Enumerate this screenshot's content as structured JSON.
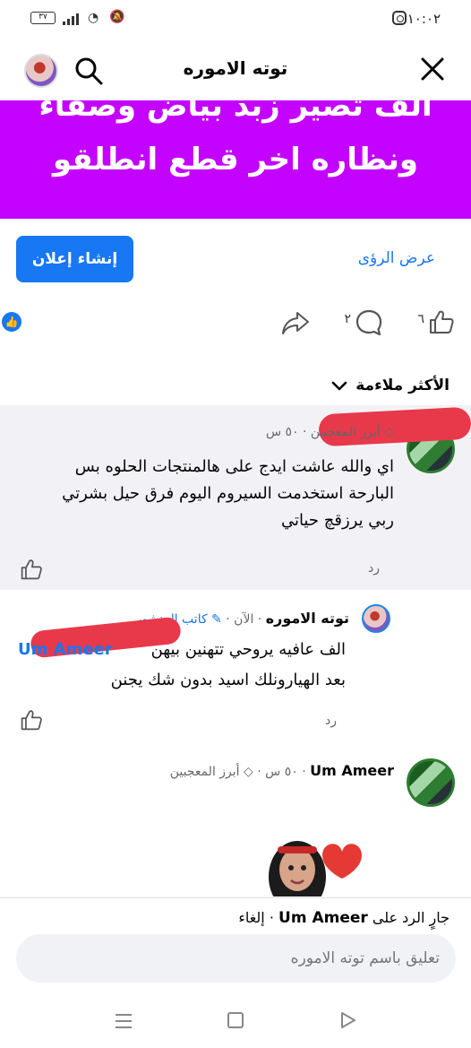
{
  "status_bar": {
    "time": "١٠:٠٢",
    "battery": "٣٧"
  },
  "header": {
    "title": "توته الاموره"
  },
  "banner": {
    "line1": "الف تصير زبد بياض وصفاء",
    "line2": "ونظاره اخر قطع انطلقو"
  },
  "actions": {
    "view_insights": "عرض الرؤى",
    "create_ad": "إنشاء إعلان"
  },
  "reactions": {
    "like_count": "٦",
    "comment_count": "٢"
  },
  "sort": {
    "label": "الأكثر ملاءمة"
  },
  "comments": [
    {
      "time": "٥٠ س",
      "badge": "أبرز المعجبين",
      "text_lines": [
        "اي والله عاشت ايدج على هالمنتجات الحلوه بس",
        "البارحة استخدمت السيروم اليوم فرق حيل بشرتي",
        "ربي يرزقچ حياتي"
      ],
      "reply": "رد"
    },
    {
      "author": "توته الاموره",
      "time": "الآن",
      "badge": "كاتب المنشور",
      "text_lines": [
        "الف عافيه يروحي تتهنين بيهن",
        "بعد الهيارونلك اسيد بدون شك يجنن"
      ],
      "mention_prefix": "Um Ameer",
      "reply": "رد"
    },
    {
      "author": "Um Ameer",
      "time": "٥٠ س",
      "badge": "أبرز المعجبين"
    }
  ],
  "reply_bar": {
    "replying_prefix": "جارٍ الرد على",
    "replying_to": "Um Ameer",
    "cancel": "إلغاء",
    "placeholder": "تعليق باسم توته الاموره"
  },
  "colors": {
    "banner": "#c402ff",
    "accent": "#1877f2",
    "highlight_bg": "#f2f2f6"
  }
}
